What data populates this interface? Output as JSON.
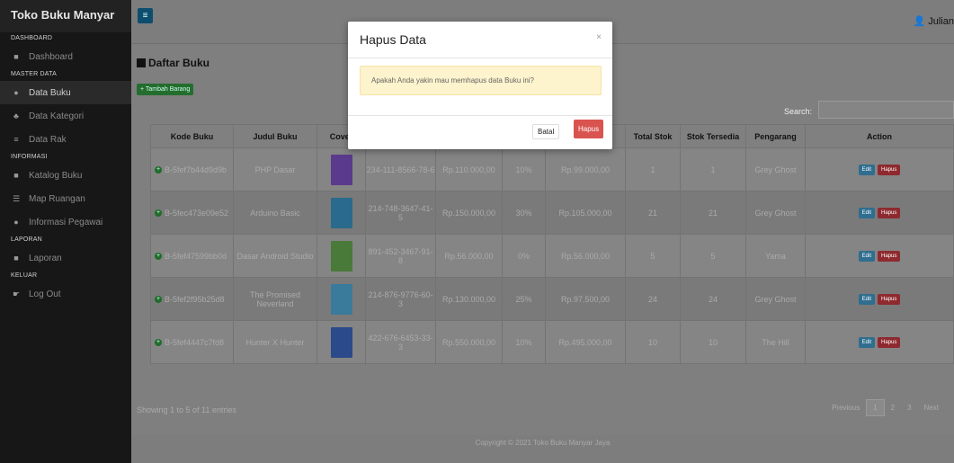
{
  "app": {
    "brand": "Toko Buku Manyar",
    "user": "Julian"
  },
  "sidebar": {
    "sections": [
      {
        "label": "DASHBOARD",
        "items": [
          {
            "label": "Dashboard",
            "icon": "book-icon"
          }
        ]
      },
      {
        "label": "MASTER DATA",
        "items": [
          {
            "label": "Data Buku",
            "icon": "gift-icon"
          },
          {
            "label": "Data Kategori",
            "icon": "tags-icon"
          },
          {
            "label": "Data Rak",
            "icon": "bars-icon"
          }
        ]
      },
      {
        "label": "INFORMASI",
        "items": [
          {
            "label": "Katalog Buku",
            "icon": "book-icon"
          },
          {
            "label": "Map Ruangan",
            "icon": "map-icon"
          },
          {
            "label": "Informasi Pegawai",
            "icon": "info-icon"
          }
        ]
      },
      {
        "label": "LAPORAN",
        "items": [
          {
            "label": "Laporan",
            "icon": "book-icon"
          }
        ]
      },
      {
        "label": "KELUAR",
        "items": [
          {
            "label": "Log Out",
            "icon": "hand-icon"
          }
        ]
      }
    ]
  },
  "main": {
    "title": "Daftar Buku",
    "add_button": "+ Tambah Barang",
    "search_label": "Search:",
    "search_value": "",
    "table": {
      "headers": [
        "Kode Buku",
        "Judul Buku",
        "Cover",
        "ISBN",
        "Harga",
        "Diskon",
        "Harga Diskon",
        "Total Stok",
        "Stok Tersedia",
        "Pengarang",
        "Action"
      ],
      "rows": [
        {
          "kode": "B-5fef7b44d9d9b",
          "judul": "PHP Dasar",
          "isbn": "234-111-8566-78-6",
          "harga": "Rp.110.000,00",
          "diskon": "10%",
          "harga_diskon": "Rp.99.000,00",
          "total_stok": "1",
          "stok_tersedia": "1",
          "pengarang": "Grey Ghost",
          "cover_color": "#5a3a8c"
        },
        {
          "kode": "B-5fec473e09e52",
          "judul": "Arduino Basic",
          "isbn": "214-748-3647-41-5",
          "harga": "Rp.150.000,00",
          "diskon": "30%",
          "harga_diskon": "Rp.105.000,00",
          "total_stok": "21",
          "stok_tersedia": "21",
          "pengarang": "Grey Ghost",
          "cover_color": "#2a6a8c"
        },
        {
          "kode": "B-5fef47599bb0d",
          "judul": "Dasar Android Studio",
          "isbn": "891-452-3467-91-8",
          "harga": "Rp.56.000,00",
          "diskon": "0%",
          "harga_diskon": "Rp.56.000,00",
          "total_stok": "5",
          "stok_tersedia": "5",
          "pengarang": "Yama",
          "cover_color": "#4a7a3a"
        },
        {
          "kode": "B-5fef2f95b25d8",
          "judul": "The Promised Neverland",
          "isbn": "214-876-9776-60-3",
          "harga": "Rp.130.000,00",
          "diskon": "25%",
          "harga_diskon": "Rp.97.500,00",
          "total_stok": "24",
          "stok_tersedia": "24",
          "pengarang": "Grey Ghost",
          "cover_color": "#3a7a9a"
        },
        {
          "kode": "B-5fef4447c7fd8",
          "judul": "Hunter X Hunter",
          "isbn": "422-676-6453-33-3",
          "harga": "Rp.550.000,00",
          "diskon": "10%",
          "harga_diskon": "Rp.495.000,00",
          "total_stok": "10",
          "stok_tersedia": "10",
          "pengarang": "The Hill",
          "cover_color": "#2a4a8a"
        }
      ],
      "edit_label": "Edit",
      "hapus_label": "Hapus"
    },
    "showing": "Showing 1 to 5 of 11 entries",
    "pagination": {
      "previous": "Previous",
      "pages": [
        "1",
        "2",
        "3"
      ],
      "current": "1",
      "next": "Next"
    }
  },
  "footer": "Copyright © 2021 Toko Buku Manyar Jaya",
  "modal": {
    "title": "Hapus Data",
    "close": "×",
    "message": "Apakah Anda yakin mau memhapus data Buku ini?",
    "cancel": "Batal",
    "confirm": "Hapus"
  }
}
